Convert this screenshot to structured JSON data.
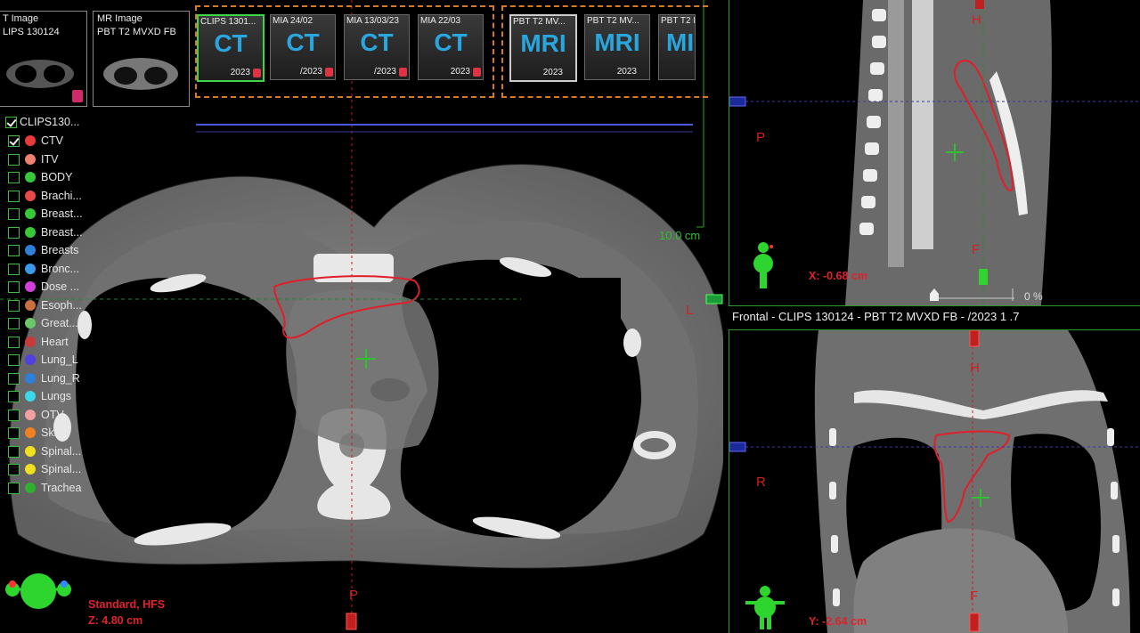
{
  "image_thumbs": [
    {
      "line1": "T Image",
      "line2": "LIPS 130124"
    },
    {
      "line1": "MR Image",
      "line2": "PBT T2 MVXD FB"
    }
  ],
  "series_groups": [
    {
      "series": [
        {
          "label": "CLIPS 1301...",
          "modality": "CT",
          "date": "2023",
          "selected": true
        },
        {
          "label": "MIA 24/02",
          "modality": "CT",
          "date": "/2023",
          "selected": false
        },
        {
          "label": "MIA 13/03/23",
          "modality": "CT",
          "date": "/2023",
          "selected": false
        },
        {
          "label": "MIA 22/03",
          "modality": "CT",
          "date": "2023",
          "selected": false
        }
      ]
    },
    {
      "series": [
        {
          "label": "PBT T2 MV...",
          "modality": "MRI",
          "date": "2023",
          "selected": true
        },
        {
          "label": "PBT T2 MV...",
          "modality": "MRI",
          "date": "2023",
          "selected": false
        },
        {
          "label": "PBT T2 MV...",
          "modality": "MI",
          "date": "",
          "selected": false
        }
      ]
    }
  ],
  "structure_set": {
    "name": "CLIPS130...",
    "checked": true
  },
  "structures": [
    {
      "name": "CTV",
      "color": "#e83a3a",
      "checked": true
    },
    {
      "name": "ITV",
      "color": "#f08070",
      "checked": false
    },
    {
      "name": "BODY",
      "color": "#36c83a",
      "checked": false
    },
    {
      "name": "Brachi...",
      "color": "#e84a4a",
      "checked": false
    },
    {
      "name": "Breast...",
      "color": "#38c838",
      "checked": false
    },
    {
      "name": "Breast...",
      "color": "#38c838",
      "checked": false
    },
    {
      "name": "Breasts",
      "color": "#2d7fd8",
      "checked": false
    },
    {
      "name": "Bronc...",
      "color": "#3a9ae8",
      "checked": false
    },
    {
      "name": "Dose ...",
      "color": "#d040d8",
      "checked": false
    },
    {
      "name": "Esoph...",
      "color": "#c87040",
      "checked": false
    },
    {
      "name": "Great...",
      "color": "#6ac86a",
      "checked": false
    },
    {
      "name": "Heart",
      "color": "#c83a3a",
      "checked": false
    },
    {
      "name": "Lung_L",
      "color": "#5040e0",
      "checked": false
    },
    {
      "name": "Lung_R",
      "color": "#2d7fd8",
      "checked": false
    },
    {
      "name": "Lungs",
      "color": "#3ad8e8",
      "checked": false
    },
    {
      "name": "OTV",
      "color": "#f0a0a0",
      "checked": false
    },
    {
      "name": "Skin",
      "color": "#f08020",
      "checked": false
    },
    {
      "name": "Spinal...",
      "color": "#f0e020",
      "checked": false
    },
    {
      "name": "Spinal...",
      "color": "#f0e020",
      "checked": false
    },
    {
      "name": "Trachea",
      "color": "#30b030",
      "checked": false
    }
  ],
  "axial": {
    "scale_label": "10.0 cm",
    "orient_left": "L",
    "orient_bottom": "P",
    "orientation": "Standard, HFS",
    "z": "Z: 4.80 cm"
  },
  "sagittal": {
    "orient_top": "H",
    "orient_left": "P",
    "orient_bottom": "F",
    "x": "X: -0.68 cm",
    "percent": "0 %"
  },
  "coronal": {
    "header": "Frontal - CLIPS 130124 - PBT  T2 MVXD FB -           /2023 1  .7",
    "orient_top": "H",
    "orient_left": "R",
    "orient_bottom": "F",
    "y": "Y: -2.64 cm"
  },
  "colors": {
    "accent_green": "#3fd44a",
    "group_border": "#d87a1d",
    "contour_red": "#e01f2a",
    "crosshair_blue": "#4a5adf"
  }
}
